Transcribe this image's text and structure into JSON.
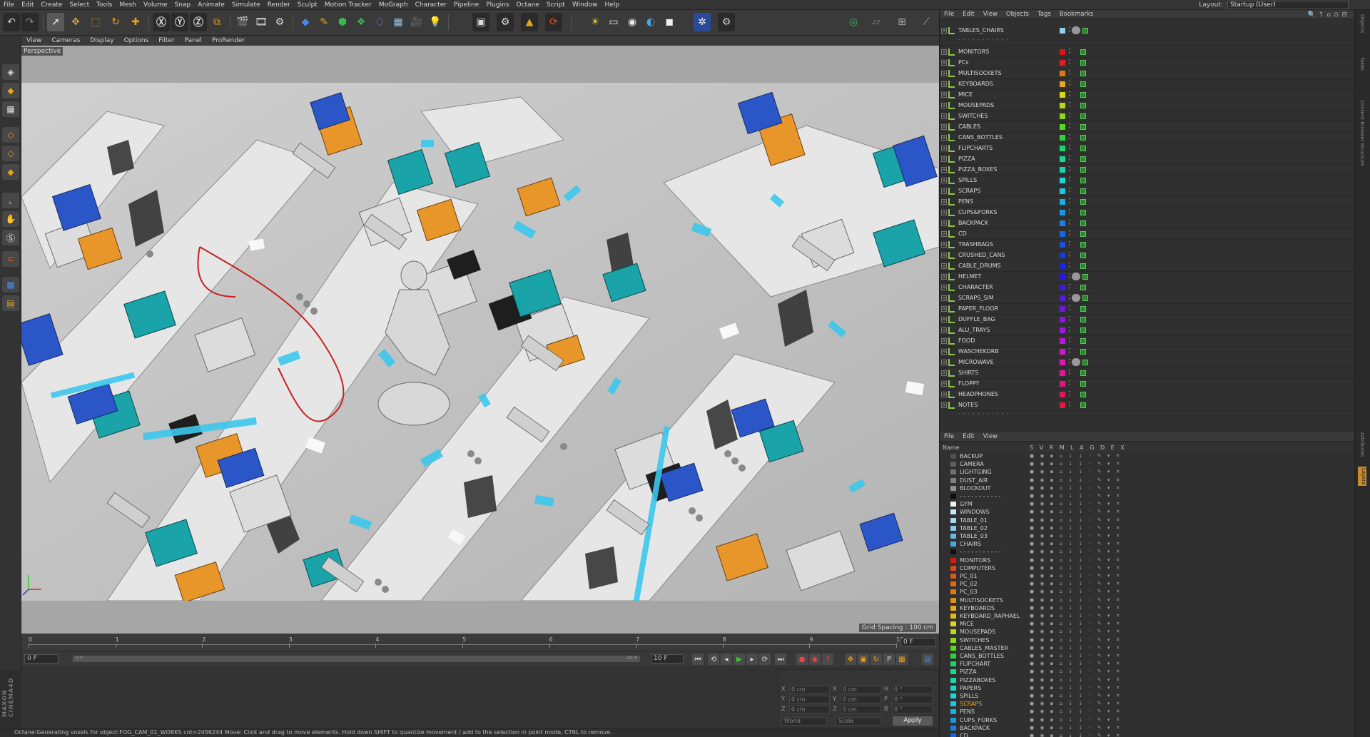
{
  "menubar": {
    "items": [
      "File",
      "Edit",
      "Create",
      "Select",
      "Tools",
      "Mesh",
      "Volume",
      "Snap",
      "Animate",
      "Simulate",
      "Render",
      "Sculpt",
      "Motion Tracker",
      "MoGraph",
      "Character",
      "Pipeline",
      "Plugins",
      "Octane",
      "Script",
      "Window",
      "Help"
    ],
    "layout_label": "Layout:",
    "layout_value": "Startup (User)"
  },
  "viewport": {
    "menu": [
      "View",
      "Cameras",
      "Display",
      "Options",
      "Filter",
      "Panel",
      "ProRender"
    ],
    "label": "Perspective",
    "grid_spacing": "Grid Spacing : 100 cm"
  },
  "timeline": {
    "ticks": [
      "0",
      "1",
      "2",
      "3",
      "4",
      "5",
      "6",
      "7",
      "8",
      "9",
      "10"
    ],
    "frame_right": "0 F"
  },
  "transport": {
    "start_field": "0 F",
    "slider_left": "0 F",
    "slider_right": "10 F",
    "end_field": "10 F"
  },
  "coords": {
    "rows": [
      {
        "a_label": "X",
        "a_val": "0 cm",
        "b_label": "X",
        "b_val": "0 cm",
        "c_label": "H",
        "c_val": "0 °"
      },
      {
        "a_label": "Y",
        "a_val": "0 cm",
        "b_label": "Y",
        "b_val": "0 cm",
        "c_label": "P",
        "c_val": "0 °"
      },
      {
        "a_label": "Z",
        "a_val": "0 cm",
        "b_label": "Z",
        "b_val": "0 cm",
        "c_label": "B",
        "c_val": "0 °"
      }
    ],
    "mode1": "World",
    "mode2": "Scale",
    "apply_label": "Apply"
  },
  "status": {
    "text": "Octane:Generating voxels for object:FOG_CAM_01_WORKS  cnt=2456244     Move: Click and drag to move elements. Hold down SHIFT to quantize movement / add to the selection in point mode, CTRL to remove."
  },
  "object_manager": {
    "menu": [
      "File",
      "Edit",
      "View",
      "Objects",
      "Tags",
      "Bookmarks"
    ],
    "top_row": {
      "name": "TABLES_CHAIRS",
      "color": "#8fd0f0"
    },
    "separator_text": "- - - - - - - - - - -",
    "objects": [
      {
        "name": "MONITORS",
        "color": "#d81818"
      },
      {
        "name": "PCs",
        "color": "#e02020"
      },
      {
        "name": "MULTISOCKETS",
        "color": "#e07818"
      },
      {
        "name": "KEYBOARDS",
        "color": "#e8a818"
      },
      {
        "name": "MICE",
        "color": "#d8d818"
      },
      {
        "name": "MOUSEPADS",
        "color": "#b8d818"
      },
      {
        "name": "SWITCHES",
        "color": "#90d818"
      },
      {
        "name": "CABLES",
        "color": "#58d818"
      },
      {
        "name": "CANS_BOTTLES",
        "color": "#28d838"
      },
      {
        "name": "FLIPCHARTS",
        "color": "#18d868"
      },
      {
        "name": "PIZZA",
        "color": "#18d890"
      },
      {
        "name": "PIZZA_BOXES",
        "color": "#18d8b0"
      },
      {
        "name": "SPILLS",
        "color": "#18d8d0"
      },
      {
        "name": "SCRAPS",
        "color": "#18c8e0"
      },
      {
        "name": "PENS",
        "color": "#18b0e0"
      },
      {
        "name": "CUPS&FORKS",
        "color": "#1898e0"
      },
      {
        "name": "BACKPACK",
        "color": "#1880e0"
      },
      {
        "name": "CD",
        "color": "#1868e0"
      },
      {
        "name": "TRASHBAGS",
        "color": "#1850e0"
      },
      {
        "name": "CRUSHED_CANS",
        "color": "#1838e0"
      },
      {
        "name": "CABLE_DRUMS",
        "color": "#1828e0"
      },
      {
        "name": "HELMET",
        "color": "#2818e0",
        "tag": true
      },
      {
        "name": "CHARACTER",
        "color": "#4018e0"
      },
      {
        "name": "SCRAPS_SIM",
        "color": "#5818e0",
        "tag": true
      },
      {
        "name": "PAPER_FLOOR",
        "color": "#7018e0"
      },
      {
        "name": "DUFFLE_BAG",
        "color": "#8818e0"
      },
      {
        "name": "ALU_TRAYS",
        "color": "#a018e0"
      },
      {
        "name": "FOOD",
        "color": "#b818d8"
      },
      {
        "name": "WASCHEKORB",
        "color": "#d018c8"
      },
      {
        "name": "MICROWAVE",
        "color": "#e018b0",
        "tag": true
      },
      {
        "name": "SHIRTS",
        "color": "#e01898"
      },
      {
        "name": "FLOPPY",
        "color": "#e01880"
      },
      {
        "name": "HEADPHONES",
        "color": "#e01860"
      },
      {
        "name": "NOTES",
        "color": "#e01840"
      }
    ],
    "bottom_separator_text": "- - - - - - - - - - -"
  },
  "layer_manager": {
    "menu": [
      "File",
      "Edit",
      "View"
    ],
    "header": {
      "name": "Name",
      "flags": "S V R M L A G D E X"
    },
    "layers": [
      {
        "name": "BACKUP",
        "color": "#505050"
      },
      {
        "name": "CAMERA",
        "color": "#606060"
      },
      {
        "name": "LIGHTGING",
        "color": "#707070"
      },
      {
        "name": "DUST_AIR",
        "color": "#808080"
      },
      {
        "name": "BLOCKOUT",
        "color": "#909090"
      },
      {
        "name": "- - - - - - - - - - -",
        "color": "#101010"
      },
      {
        "name": "GYM",
        "color": "#f0f0f0"
      },
      {
        "name": "WINDOWS",
        "color": "#c8e8f8"
      },
      {
        "name": "TABLE_01",
        "color": "#a8d8f0"
      },
      {
        "name": "TABLE_02",
        "color": "#88c8e8"
      },
      {
        "name": "TABLE_03",
        "color": "#68b8e0"
      },
      {
        "name": "CHAIRS",
        "color": "#48a8d8"
      },
      {
        "name": "- - - - - - - - - - -",
        "color": "#101010"
      },
      {
        "name": "MONITORS",
        "color": "#d81818"
      },
      {
        "name": "COMPUTERS",
        "color": "#e04818"
      },
      {
        "name": "PC_01",
        "color": "#e05818"
      },
      {
        "name": "PC_02",
        "color": "#e06818"
      },
      {
        "name": "PC_03",
        "color": "#e07818"
      },
      {
        "name": "MULTISOCKETS",
        "color": "#e09018"
      },
      {
        "name": "KEYBOARDS",
        "color": "#e8a818"
      },
      {
        "name": "KEYBOARD_RAPHAEL",
        "color": "#e8b818"
      },
      {
        "name": "MICE",
        "color": "#d8d818"
      },
      {
        "name": "MOUSEPADS",
        "color": "#b8d818"
      },
      {
        "name": "SWITCHES",
        "color": "#90d818"
      },
      {
        "name": "CABLES_MASTER",
        "color": "#58d818"
      },
      {
        "name": "CANS_BOTTLES",
        "color": "#28d838"
      },
      {
        "name": "FLIPCHART",
        "color": "#18d868"
      },
      {
        "name": "PIZZA",
        "color": "#18d890"
      },
      {
        "name": "PIZZABOXES",
        "color": "#18d8b0"
      },
      {
        "name": "PAPERS",
        "color": "#18d8c8"
      },
      {
        "name": "SPILLS",
        "color": "#18d8d8"
      },
      {
        "name": "SCRAPS",
        "color": "#18c8e0",
        "highlight": true
      },
      {
        "name": "PENS",
        "color": "#18b0e0"
      },
      {
        "name": "CUPS_FORKS",
        "color": "#1898e0"
      },
      {
        "name": "BACKPACK",
        "color": "#1880e0"
      },
      {
        "name": "CD",
        "color": "#1868e0"
      }
    ]
  },
  "side_tabs": [
    "Objects",
    "Takes",
    "Content Browser",
    "Structure"
  ],
  "side_tabs_lower": [
    "Attributes",
    "Layers"
  ],
  "colors": {
    "ui_dark": "#2d2d2d",
    "accent_orange": "#c88a2a",
    "scene_teal": "#1aa3a8",
    "scene_orange": "#e8962a",
    "scene_blue": "#2b56c8",
    "scene_cyan": "#3cc8ec"
  }
}
